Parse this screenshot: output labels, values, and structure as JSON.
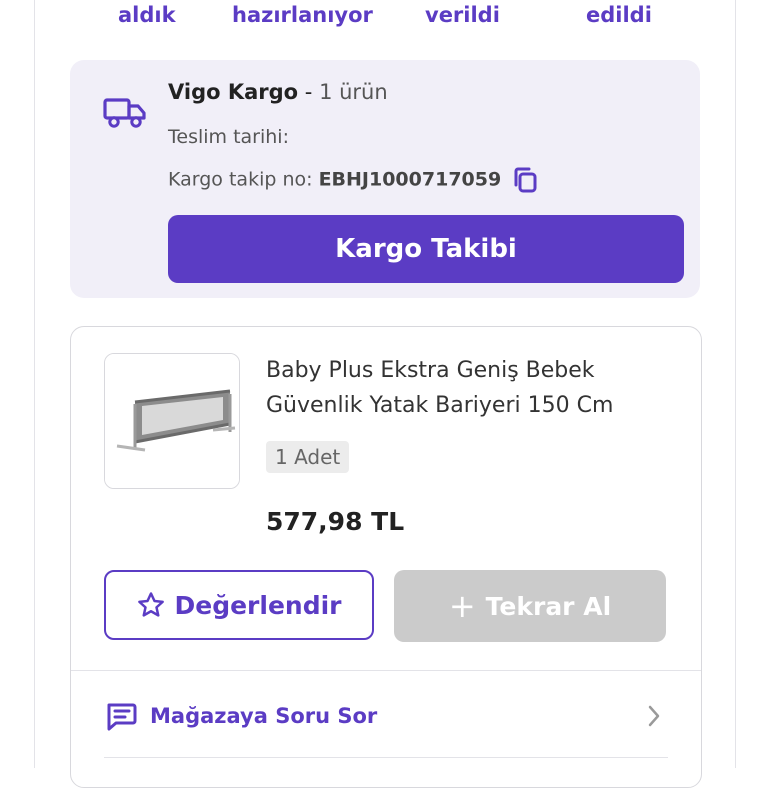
{
  "steps": [
    "aldık",
    "hazırlanıyor",
    "verildi",
    "edildi"
  ],
  "shipment": {
    "carrier_name": "Vigo Kargo",
    "separator": " - ",
    "item_count": "1 ürün",
    "delivery_label": "Teslim tarihi:",
    "tracking_label": "Kargo takip no: ",
    "tracking_no": "EBHJ1000717059",
    "track_button": "Kargo Takibi"
  },
  "product": {
    "name": "Baby Plus Ekstra Geniş Bebek Güvenlik Yatak Bariyeri 150 Cm",
    "quantity": "1 Adet",
    "price": "577,98 TL",
    "rate_button": "Değerlendir",
    "reorder_button": "Tekrar Al"
  },
  "actions": {
    "ask_store": "Mağazaya Soru Sor"
  },
  "colors": {
    "accent": "#5b3cc4",
    "panel": "#f1eff8",
    "disabled": "#cbcbcb"
  }
}
